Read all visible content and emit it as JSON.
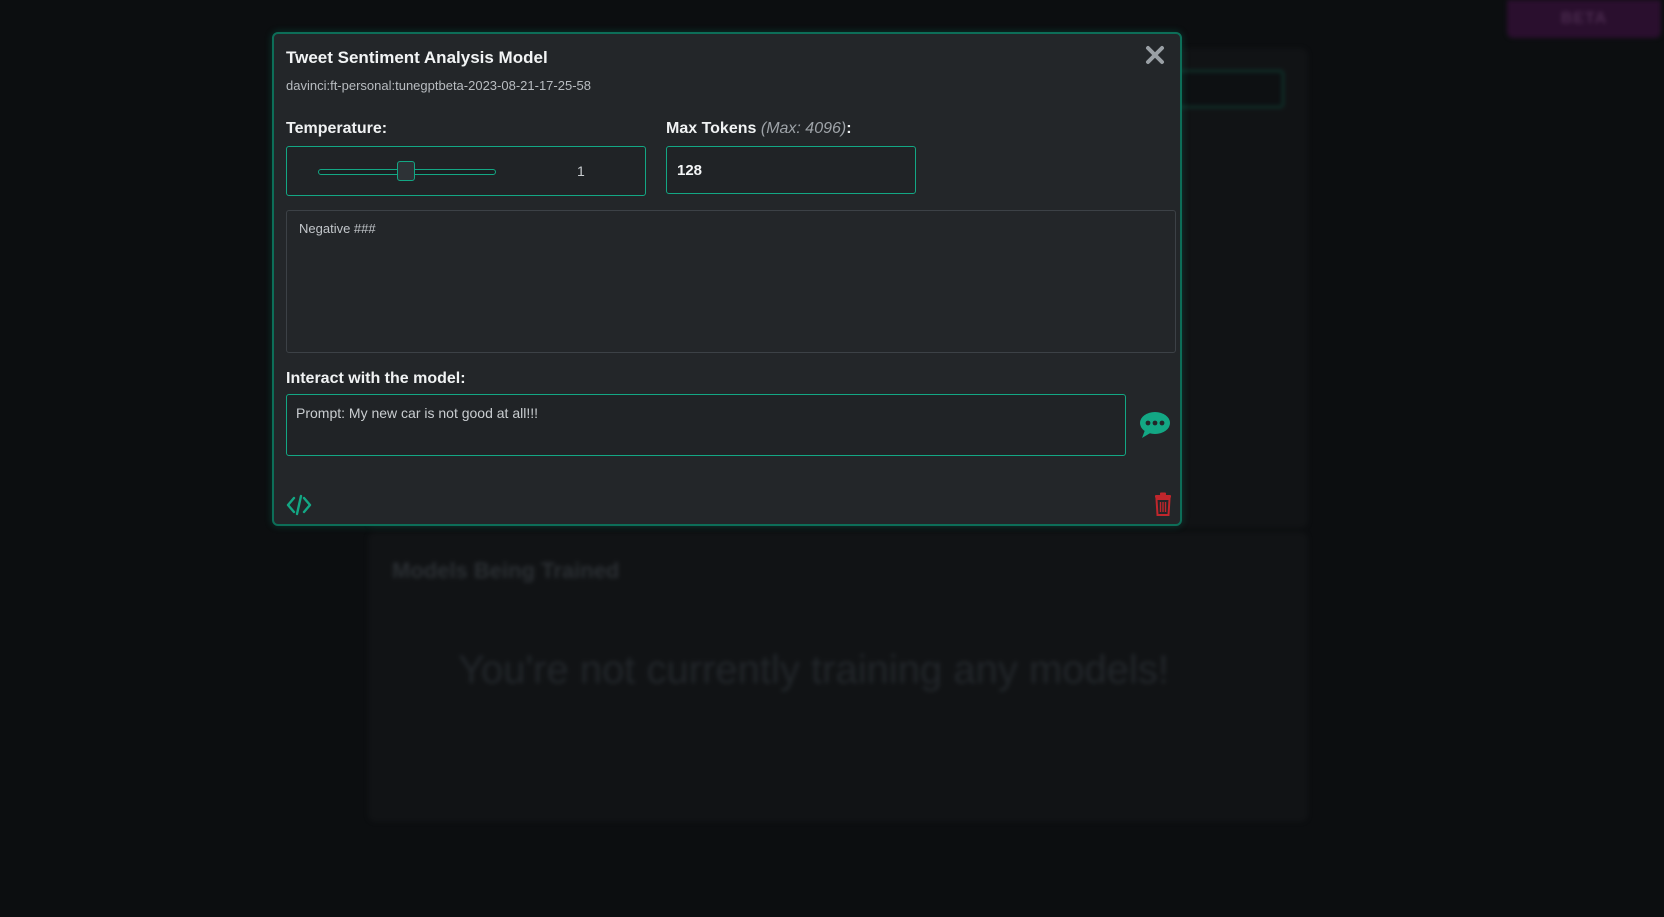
{
  "background": {
    "beta_badge": "BETA",
    "training_title": "Models Being Trained",
    "empty_message": "You're not currently training any models!"
  },
  "modal": {
    "title": "Tweet Sentiment Analysis Model",
    "model_id": "davinci:ft-personal:tunegptbeta-2023-08-21-17-25-58",
    "close_icon": "close-icon",
    "temperature": {
      "label": "Temperature:",
      "value": "1",
      "slider_fraction": 0.5
    },
    "max_tokens": {
      "label": "Max Tokens",
      "max_note": "(Max: 4096)",
      "suffix": ":",
      "value": "128"
    },
    "response_text": "Negative ###",
    "interact": {
      "label": "Interact with the model:",
      "prompt_value": "Prompt: My new car is not good at all!!!"
    },
    "icons": {
      "send": "chat-bubble-icon",
      "code": "code-icon",
      "delete": "trash-icon"
    },
    "colors": {
      "accent": "#13a784",
      "danger": "#c0262c",
      "panel": "#232629"
    }
  }
}
